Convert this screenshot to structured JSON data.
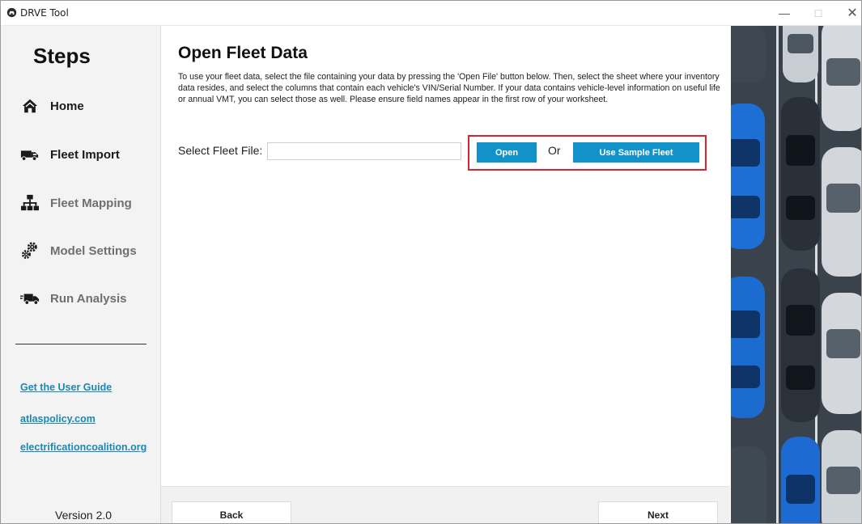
{
  "window": {
    "title": "DRVE Tool",
    "minimize": "—",
    "maximize": "□",
    "close": "✕"
  },
  "sidebar": {
    "heading": "Steps",
    "items": [
      {
        "label": "Home",
        "icon": "home-icon",
        "state": "active"
      },
      {
        "label": "Fleet Import",
        "icon": "truck-icon",
        "state": "active"
      },
      {
        "label": "Fleet Mapping",
        "icon": "hierarchy-icon",
        "state": "inactive"
      },
      {
        "label": "Model Settings",
        "icon": "gears-icon",
        "state": "inactive"
      },
      {
        "label": "Run Analysis",
        "icon": "truck-run-icon",
        "state": "inactive"
      }
    ],
    "links": [
      "Get the User Guide",
      "atlaspolicy.com",
      "electrificationcoalition.org"
    ],
    "version": "Version 2.0"
  },
  "main": {
    "title": "Open Fleet Data",
    "description": "To use your fleet data, select the file containing your data by pressing the 'Open File' button below. Then, select the sheet where your inventory data resides, and select the columns that contain each vehicle's VIN/Serial Number. If your data contains vehicle-level information on useful life or annual VMT, you can select those as well. Please ensure field names appear in the first row of your worksheet.",
    "fleet_file": {
      "label": "Select Fleet File:",
      "value": ""
    },
    "open_button": "Open",
    "or_text": "Or",
    "sample_button": "Use Sample Fleet",
    "back_button": "Back",
    "next_button": "Next"
  },
  "colors": {
    "accent": "#1193c9",
    "link": "#1b88b4",
    "highlight": "#d9232e",
    "sidebar_bg": "#f3f3f3"
  }
}
